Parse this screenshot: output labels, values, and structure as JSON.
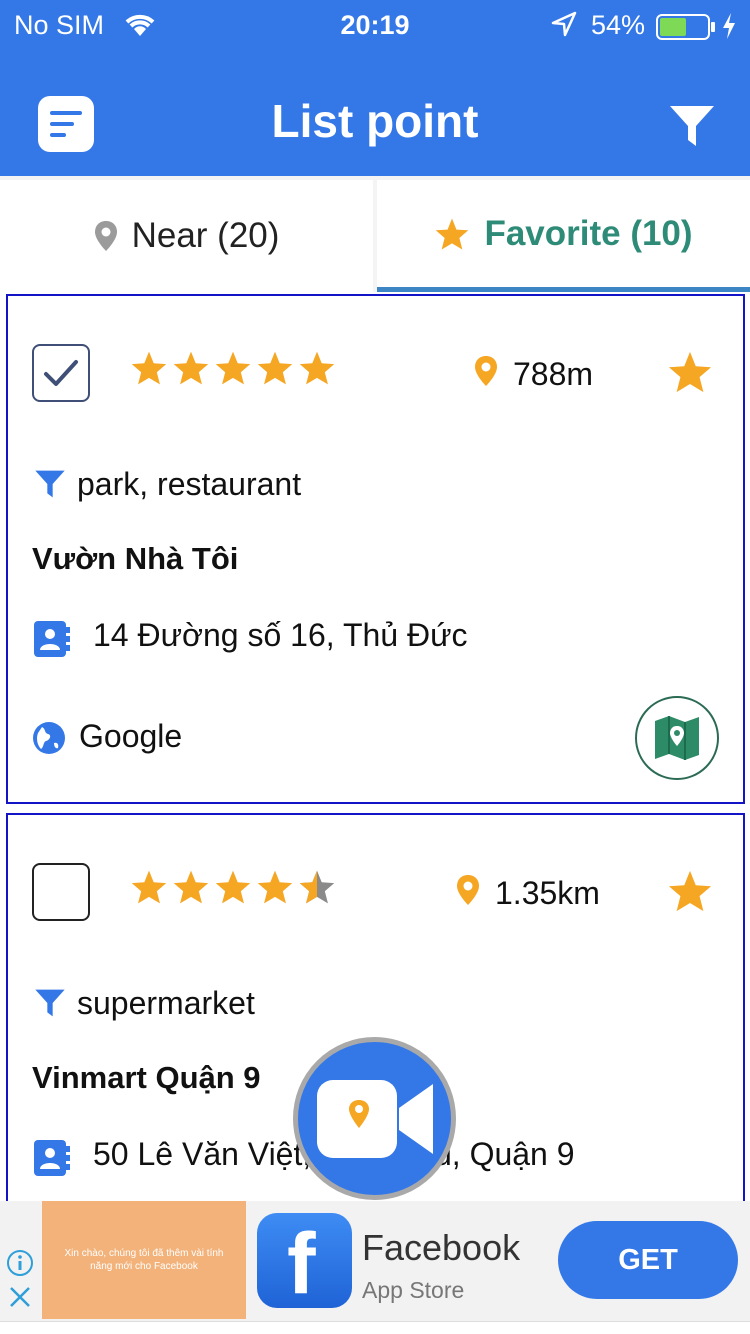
{
  "status_bar": {
    "carrier": "No SIM",
    "time": "20:19",
    "battery": "54%"
  },
  "header": {
    "title": "List point"
  },
  "tabs": [
    {
      "label": "Near (20)",
      "icon": "map-pin-icon",
      "active": false
    },
    {
      "label": "Favorite (10)",
      "icon": "star-icon",
      "active": true
    }
  ],
  "places": [
    {
      "checked": true,
      "rating": 5,
      "distance": "788m",
      "types": "park, restaurant",
      "name": "Vườn Nhà Tôi",
      "address": "14 Đường số 16, Thủ Đức",
      "source": "Google"
    },
    {
      "checked": false,
      "rating": 4.5,
      "distance": "1.35km",
      "types": "supermarket",
      "name": "Vinmart Quận 9",
      "address": "50 Lê Văn Việt, Hiệp Phú, Quận 9",
      "source": ""
    }
  ],
  "ad": {
    "thumbnail_text": "Xin chào, chúng tôi đã thêm vài tính năng mới cho Facebook",
    "logo_letter": "f",
    "title": "Facebook",
    "subtitle": "App Store",
    "cta": "GET"
  },
  "colors": {
    "primary": "#3478e8",
    "star": "#f5a623",
    "favorite_text": "#2e8b77",
    "card_border": "#1313c8"
  }
}
